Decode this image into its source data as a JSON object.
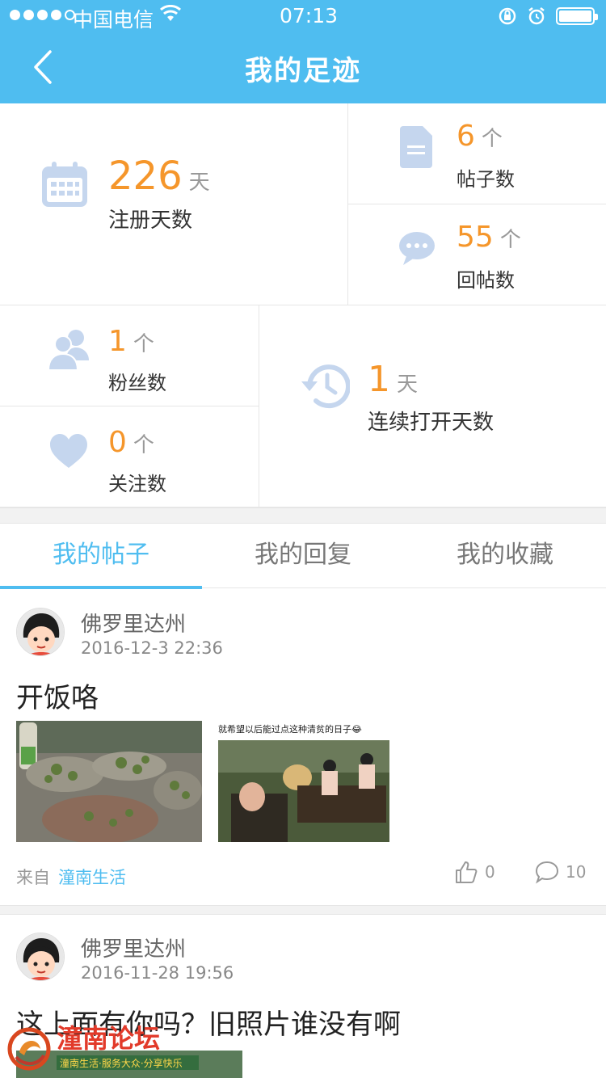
{
  "status_bar": {
    "carrier": "中国电信",
    "time": "07:13"
  },
  "nav": {
    "title": "我的足迹",
    "back_icon": "chevron-left-icon"
  },
  "stats": {
    "register_days": {
      "value": "226",
      "unit": "天",
      "label": "注册天数",
      "icon": "calendar-icon"
    },
    "posts": {
      "value": "6",
      "unit": "个",
      "label": "帖子数",
      "icon": "document-icon"
    },
    "replies": {
      "value": "55",
      "unit": "个",
      "label": "回帖数",
      "icon": "chat-bubble-icon"
    },
    "fans": {
      "value": "1",
      "unit": "个",
      "label": "粉丝数",
      "icon": "users-icon"
    },
    "following": {
      "value": "0",
      "unit": "个",
      "label": "关注数",
      "icon": "heart-icon"
    },
    "streak": {
      "value": "1",
      "unit": "天",
      "label": "连续打开天数",
      "icon": "history-icon"
    }
  },
  "tabs": [
    {
      "label": "我的帖子",
      "active": true
    },
    {
      "label": "我的回复",
      "active": false
    },
    {
      "label": "我的收藏",
      "active": false
    }
  ],
  "posts": [
    {
      "author": "佛罗里达州",
      "time": "2016-12-3 22:36",
      "title": "开饭咯",
      "image2_caption": "就希望以后能过点这种清贫的日子😂",
      "from_label": "来自",
      "source": "潼南生活",
      "likes": "0",
      "comments": "10"
    },
    {
      "author": "佛罗里达州",
      "time": "2016-11-28 19:56",
      "title": "这上面有你吗？旧照片谁没有啊"
    }
  ],
  "watermark": {
    "name": "潼南论坛",
    "slogan": "潼南生活·服务大众·分享快乐"
  },
  "colors": {
    "accent": "#4fbdf0",
    "number": "#f5962b",
    "icon": "#c5d6ee"
  }
}
